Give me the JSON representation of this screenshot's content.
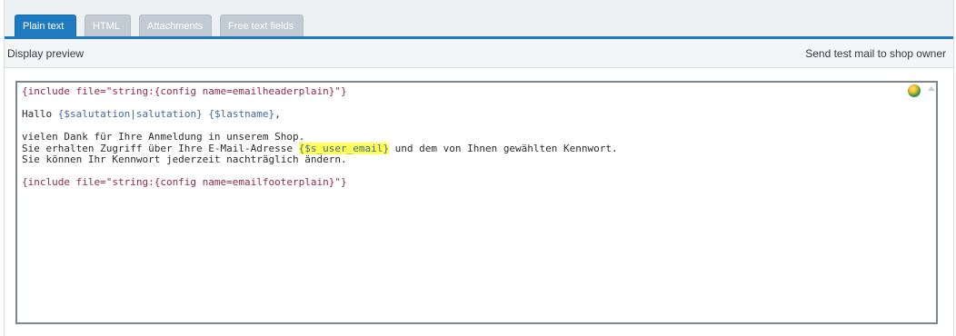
{
  "tabs": [
    {
      "label": "Plain text",
      "active": true
    },
    {
      "label": "HTML",
      "active": false
    },
    {
      "label": "Attachments",
      "active": false
    },
    {
      "label": "Free text fields",
      "active": false
    }
  ],
  "toolbar": {
    "preview_label": "Display preview",
    "test_mail_label": "Send test mail to shop owner"
  },
  "editor": {
    "line1": "{include file=\"string:{config name=emailheaderplain}\"}",
    "line2_prefix": "Hallo ",
    "line2_var1": "{$salutation|salutation}",
    "line2_space": " ",
    "line2_var2": "{$lastname}",
    "line2_suffix": ",",
    "line3": "vielen Dank für Ihre Anmeldung in unserem Shop.",
    "line4_prefix": "Sie erhalten Zugriff über Ihre E-Mail-Adresse ",
    "line4_var": "{$s_user_email}",
    "line4_suffix": " und dem von Ihnen gewählten Kennwort.",
    "line5": "Sie können Ihr Kennwort jederzeit nachträglich ändern.",
    "line6": "{include file=\"string:{config name=emailfooterplain}\"}"
  },
  "icons": {
    "globe": "globe-icon",
    "scroll_up": "scroll-up-arrow-icon"
  },
  "colors": {
    "accent": "#1f7bc1",
    "template_tag": "#8e2a4a",
    "template_var": "#3c6aa6",
    "highlight": "#ffff55"
  }
}
